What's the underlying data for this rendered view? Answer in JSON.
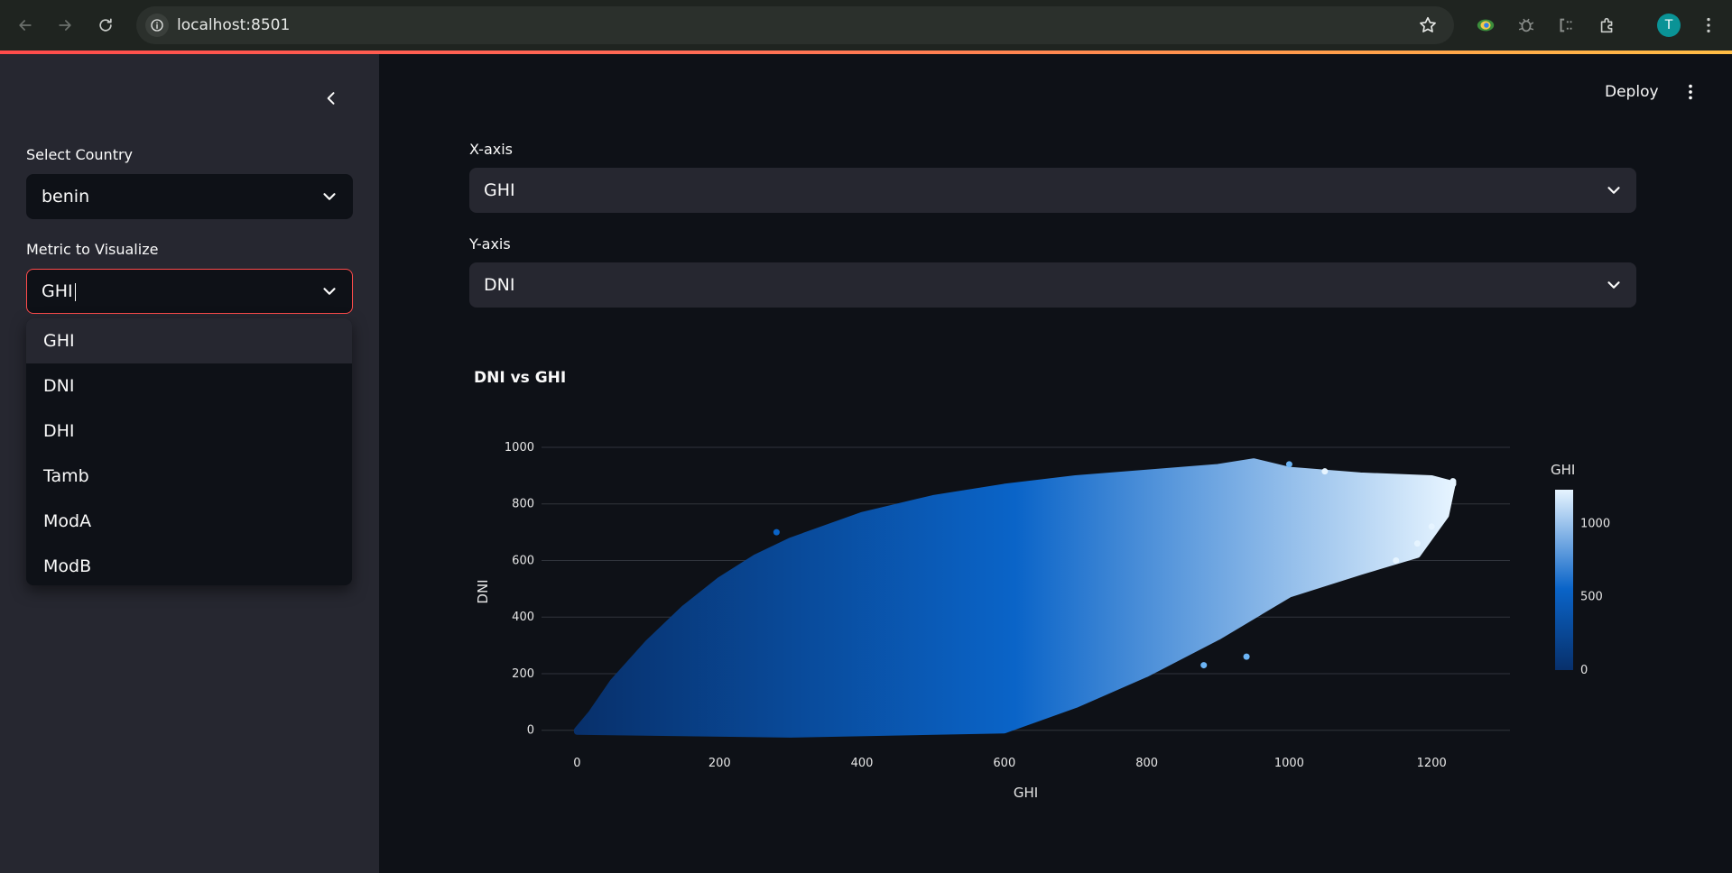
{
  "browser": {
    "url": "localhost:8501",
    "avatar_letter": "T"
  },
  "sidebar": {
    "country_label": "Select Country",
    "country_value": "benin",
    "metric_label": "Metric to Visualize",
    "metric_value": "GHI",
    "metric_options": [
      "GHI",
      "DNI",
      "DHI",
      "Tamb",
      "ModA",
      "ModB"
    ],
    "metric_highlighted": "GHI"
  },
  "header": {
    "deploy_label": "Deploy"
  },
  "main": {
    "x_axis_label": "X-axis",
    "x_axis_value": "GHI",
    "y_axis_label": "Y-axis",
    "y_axis_value": "DNI"
  },
  "colors": {
    "accent": "#ff4b4b",
    "sidebar_bg": "#262730",
    "app_bg": "#0e1117",
    "scale_low": "#08306b",
    "scale_mid": "#0a64c8",
    "scale_high": "#e6f4ff"
  },
  "chart_data": {
    "type": "scatter",
    "title": "DNI vs GHI",
    "xlabel": "GHI",
    "ylabel": "DNI",
    "xlim": [
      -50,
      1310
    ],
    "ylim": [
      -20,
      1000
    ],
    "x_ticks": [
      0,
      200,
      400,
      600,
      800,
      1000,
      1200
    ],
    "y_ticks": [
      0,
      200,
      400,
      600,
      800,
      1000
    ],
    "grid": true,
    "color_by": "GHI",
    "colorbar": {
      "title": "GHI",
      "range": [
        0,
        1230
      ],
      "ticks": [
        0,
        500,
        1000
      ]
    },
    "point_cloud": {
      "upper_envelope": [
        [
          0,
          0
        ],
        [
          20,
          60
        ],
        [
          50,
          170
        ],
        [
          100,
          310
        ],
        [
          150,
          430
        ],
        [
          200,
          530
        ],
        [
          250,
          610
        ],
        [
          300,
          670
        ],
        [
          400,
          760
        ],
        [
          500,
          820
        ],
        [
          600,
          860
        ],
        [
          700,
          890
        ],
        [
          800,
          910
        ],
        [
          900,
          930
        ],
        [
          950,
          950
        ],
        [
          1000,
          920
        ],
        [
          1100,
          900
        ],
        [
          1200,
          890
        ],
        [
          1230,
          870
        ]
      ],
      "lower_envelope": [
        [
          1230,
          880
        ],
        [
          1220,
          760
        ],
        [
          1180,
          620
        ],
        [
          1100,
          560
        ],
        [
          1000,
          480
        ],
        [
          900,
          330
        ],
        [
          800,
          200
        ],
        [
          700,
          90
        ],
        [
          600,
          0
        ],
        [
          300,
          -15
        ],
        [
          0,
          -5
        ]
      ],
      "outliers": [
        [
          280,
          700
        ],
        [
          940,
          260
        ],
        [
          880,
          230
        ],
        [
          1180,
          660
        ],
        [
          1150,
          600
        ],
        [
          1200,
          720
        ],
        [
          1000,
          940
        ],
        [
          1050,
          915
        ]
      ]
    }
  }
}
